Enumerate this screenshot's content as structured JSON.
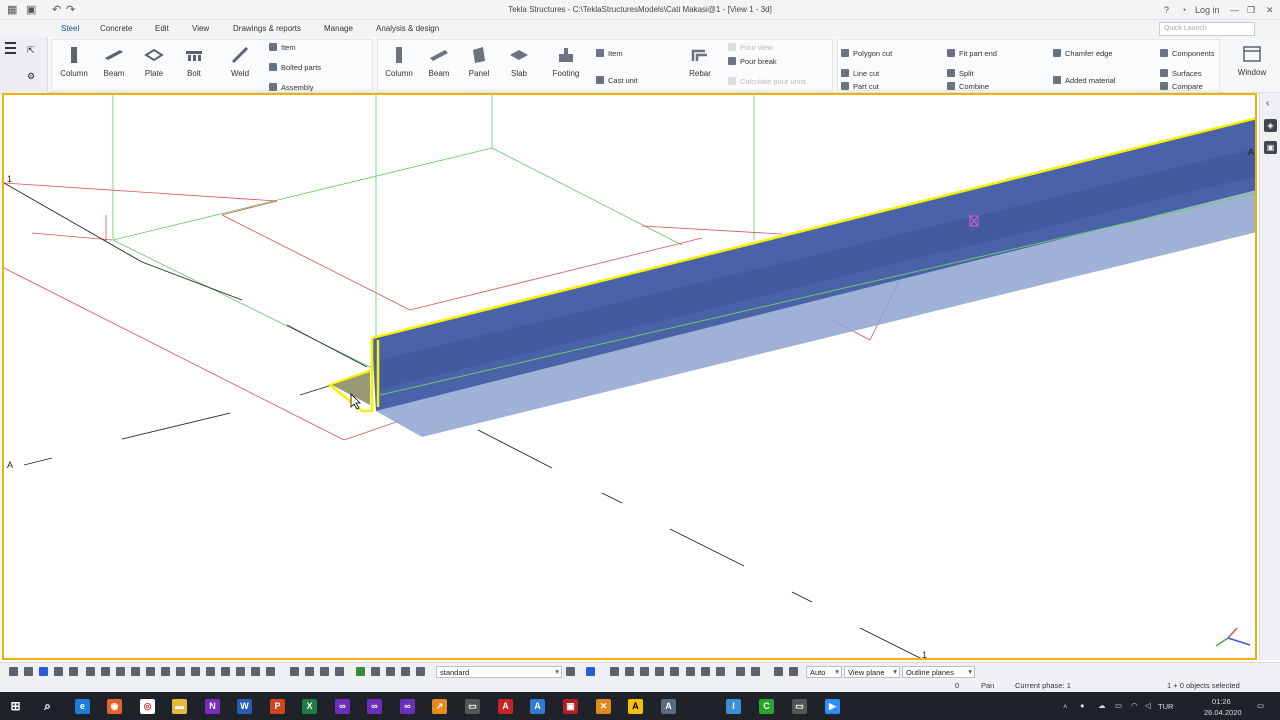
{
  "window": {
    "title": "Tekla Structures - C:\\TeklaStructuresModels\\Cati Makasi@1 - [View 1 - 3d]",
    "help": "?",
    "login": "Log in"
  },
  "menu": {
    "tabs": [
      "Steel",
      "Concrete",
      "Edit",
      "View",
      "Drawings & reports",
      "Manage",
      "Analysis & design"
    ],
    "active": "Steel",
    "quick_launch_placeholder": "Quick Launch"
  },
  "ribbon": {
    "steel": {
      "column": "Column",
      "beam": "Beam",
      "plate": "Plate",
      "bolt": "Bolt",
      "weld": "Weld",
      "item": "Item",
      "bolted_parts": "Bolted parts",
      "assembly": "Assembly"
    },
    "concrete": {
      "column": "Column",
      "beam": "Beam",
      "panel": "Panel",
      "slab": "Slab",
      "footing": "Footing",
      "item": "Item",
      "cast_unit": "Cast unit",
      "rebar": "Rebar",
      "pour_view": "Pour view",
      "pour_break": "Pour break",
      "calculate_pour_units": "Calculate pour units"
    },
    "edit": {
      "polygon_cut": "Polygon cut",
      "line_cut": "Line cut",
      "part_cut": "Part cut",
      "fit_part_end": "Fit part end",
      "split": "Split",
      "combine": "Combine",
      "chamfer_edge": "Chamfer edge",
      "added_material": "Added material",
      "components": "Components",
      "surfaces": "Surfaces",
      "compare": "Compare",
      "window": "Window"
    }
  },
  "viewport": {
    "grid_labels": [
      "1",
      "A",
      "A",
      "1"
    ],
    "view_name": "View 1 - 3d"
  },
  "statusbar": {
    "filter": "standard",
    "snap_mode": "Auto",
    "plane": "View plane",
    "outline": "Outline planes"
  },
  "infobar": {
    "coord": "0",
    "mode": "Pan",
    "phase": "Current phase: 1",
    "selection": "1 + 0 objects selected"
  },
  "taskbar": {
    "time": "01:26",
    "date": "26.04.2020",
    "lang": "TUR"
  },
  "colors": {
    "accent": "#f2b000",
    "beam_fill": "#4a63a8",
    "selection": "#f7f200",
    "grid_green": "#5ecb5e",
    "grid_red": "#d9534f"
  }
}
